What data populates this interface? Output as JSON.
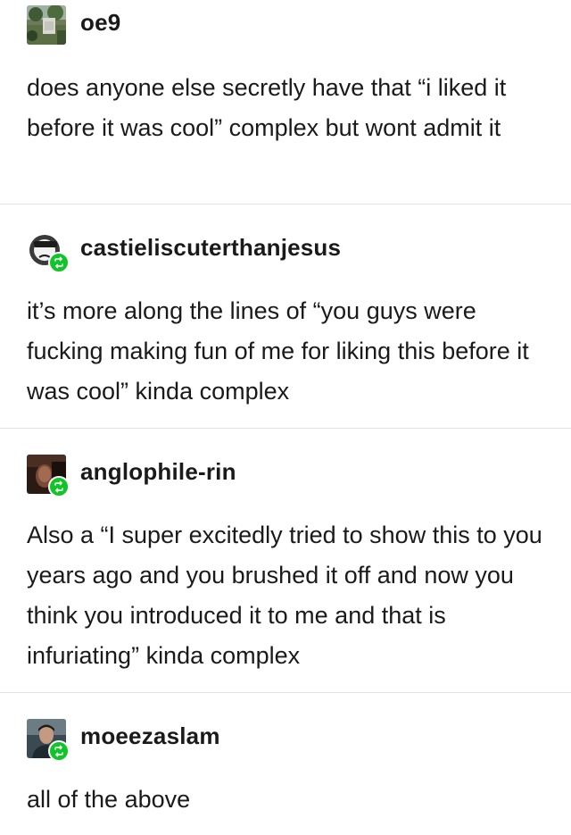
{
  "posts": [
    {
      "username": "oe9",
      "reblog": false,
      "avatar_icon": "landscape-photo-avatar",
      "text": "does anyone else secretly have that “i liked it before it was cool” complex but wont admit it"
    },
    {
      "username": "castieliscuterthanjesus",
      "reblog": true,
      "avatar_icon": "sunglasses-face-avatar",
      "text": "it’s more along the lines of “you guys were fucking making fun of me for liking this before it was cool” kinda complex"
    },
    {
      "username": "anglophile-rin",
      "reblog": true,
      "avatar_icon": "portrait-photo-avatar",
      "text": "Also a “I super excitedly tried to show this to you years ago and you brushed it off and now you think you introduced it to me and that is infuriating” kinda complex"
    },
    {
      "username": "moeezaslam",
      "reblog": true,
      "avatar_icon": "person-photo-avatar",
      "text": "all of the above"
    }
  ],
  "colors": {
    "reblog_badge": "#10c42a",
    "divider": "#e2e2e2",
    "text": "#1a1a1a"
  }
}
